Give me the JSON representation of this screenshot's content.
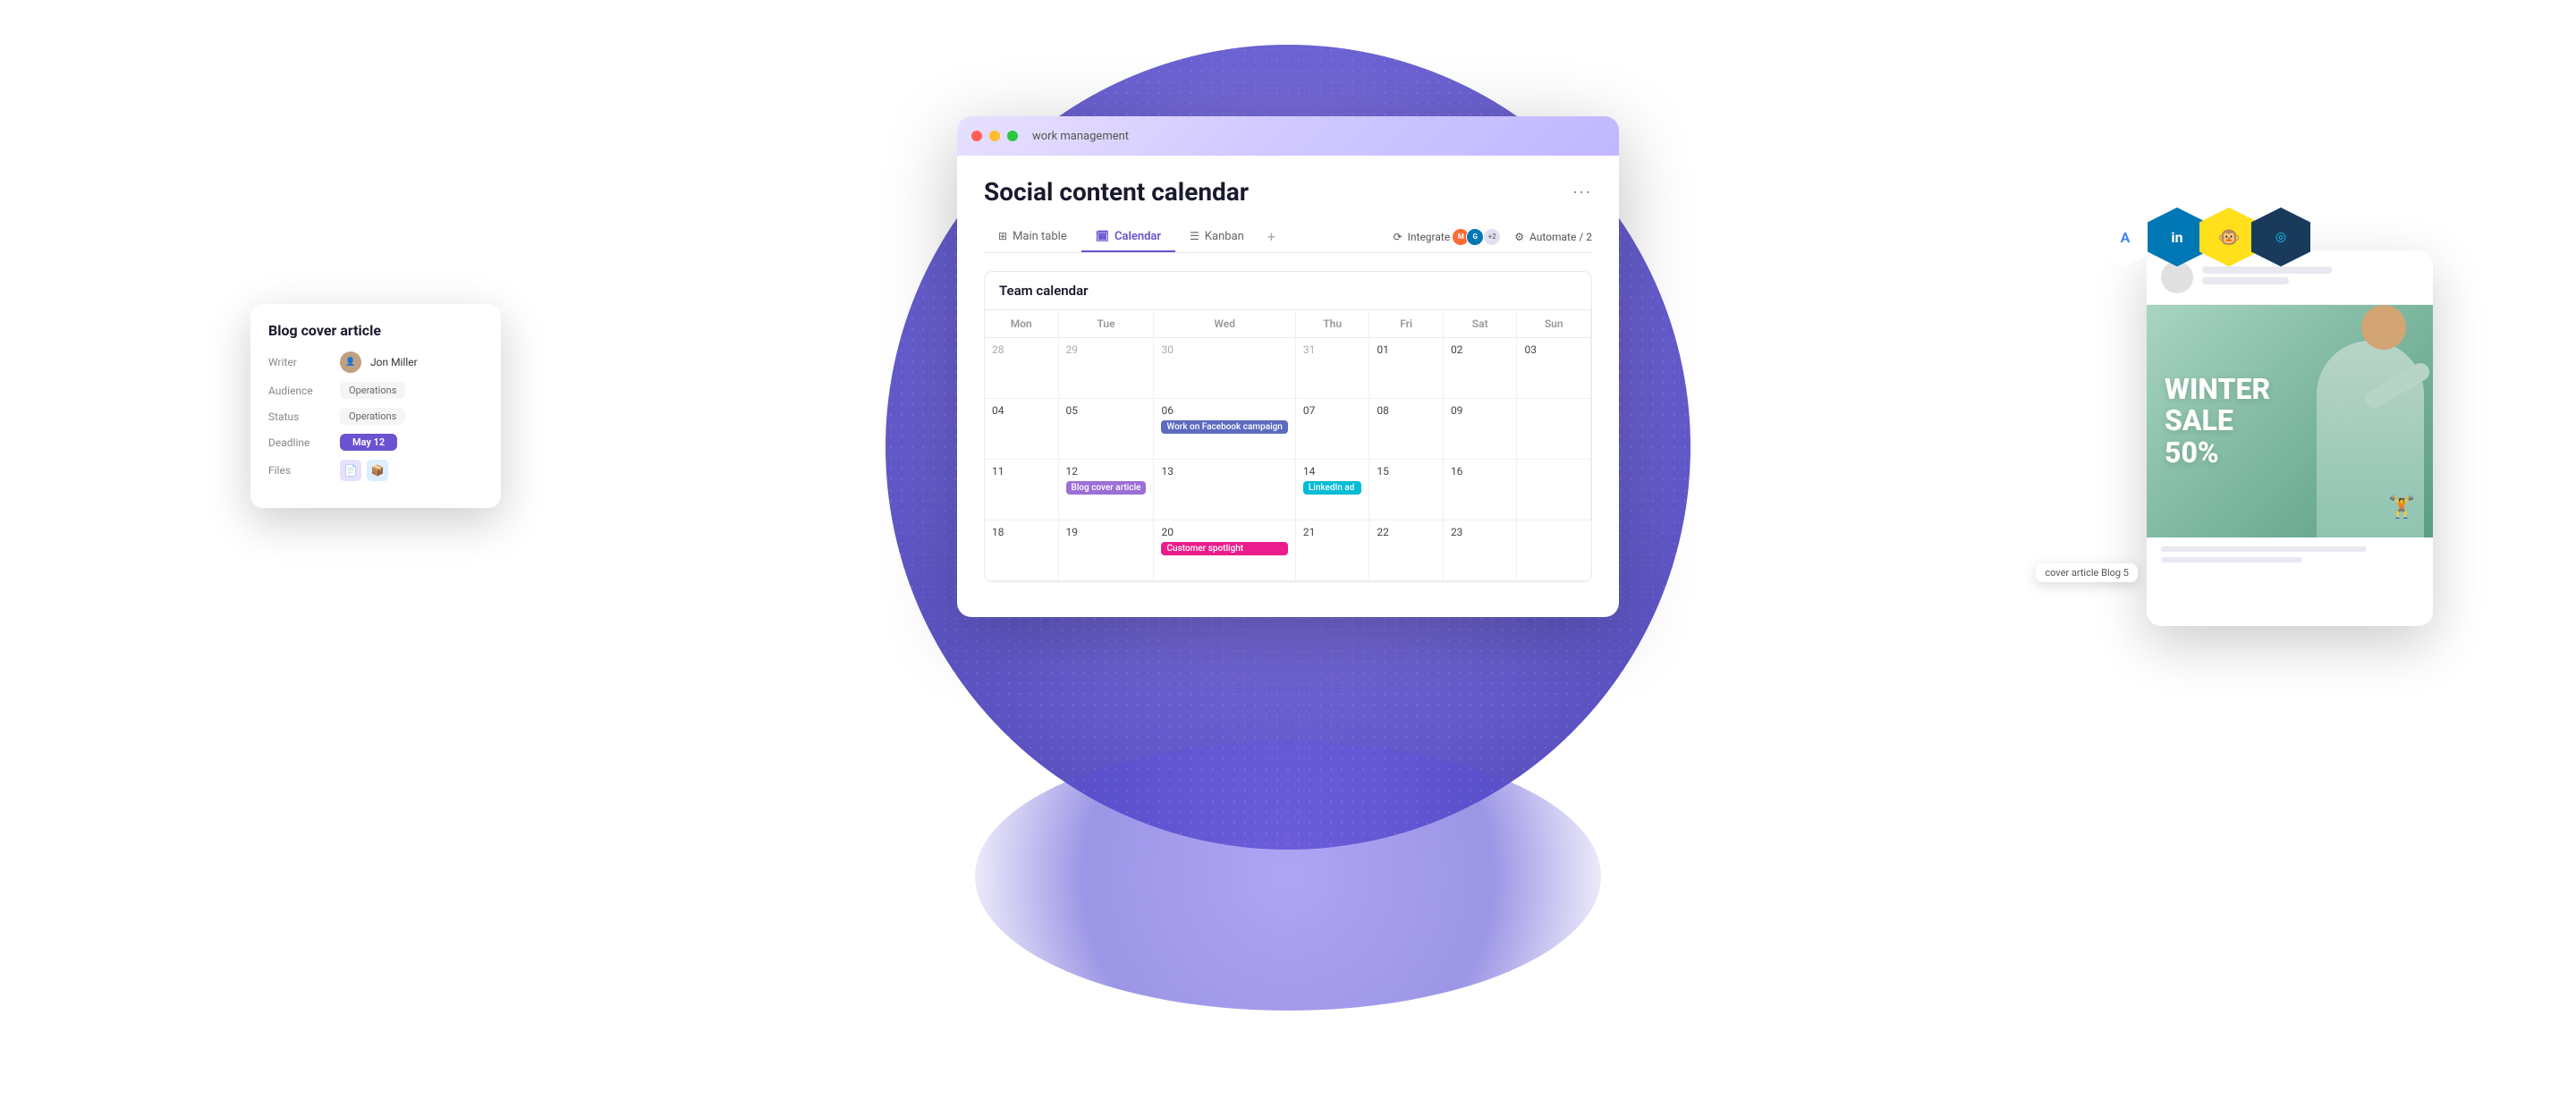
{
  "background": {
    "circle_color_start": "#7b68ee",
    "circle_color_end": "#4a3fc4"
  },
  "window": {
    "title": "work management",
    "buttons": [
      "close",
      "minimize",
      "maximize"
    ]
  },
  "app": {
    "title": "Social content calendar",
    "more_button": "···",
    "tabs": [
      {
        "id": "main-table",
        "label": "Main table",
        "icon": "⊞",
        "active": false
      },
      {
        "id": "calendar",
        "label": "Calendar",
        "icon": "📅",
        "active": true
      },
      {
        "id": "kanban",
        "label": "Kanban",
        "icon": "⊟",
        "active": false
      }
    ],
    "tab_add": "+",
    "actions": {
      "integrate": "Integrate",
      "integrate_count": "+2",
      "automate": "Automate / 2"
    }
  },
  "calendar": {
    "header": "Team calendar",
    "days": [
      "Mon",
      "Tue",
      "Wed",
      "Thu",
      "Fri",
      "Sat",
      "Sun"
    ],
    "weeks": [
      {
        "days": [
          {
            "num": "28",
            "current": false,
            "events": []
          },
          {
            "num": "29",
            "current": false,
            "events": []
          },
          {
            "num": "30",
            "current": false,
            "events": []
          },
          {
            "num": "31",
            "current": false,
            "events": []
          },
          {
            "num": "01",
            "current": true,
            "events": []
          },
          {
            "num": "02",
            "current": true,
            "events": []
          },
          {
            "num": "03",
            "current": true,
            "events": []
          }
        ]
      },
      {
        "days": [
          {
            "num": "04",
            "current": true,
            "events": []
          },
          {
            "num": "05",
            "current": true,
            "events": []
          },
          {
            "num": "06",
            "current": true,
            "events": [
              {
                "label": "Work on Facebook campaign",
                "color": "blue",
                "span": 3
              }
            ]
          },
          {
            "num": "07",
            "current": true,
            "events": []
          },
          {
            "num": "08",
            "current": true,
            "events": []
          },
          {
            "num": "09",
            "current": true,
            "events": []
          },
          {
            "num": "",
            "current": false,
            "events": []
          }
        ]
      },
      {
        "days": [
          {
            "num": "11",
            "current": true,
            "events": []
          },
          {
            "num": "12",
            "current": true,
            "events": [
              {
                "label": "Blog cover article",
                "color": "purple-light"
              }
            ]
          },
          {
            "num": "13",
            "current": true,
            "events": []
          },
          {
            "num": "14",
            "current": true,
            "events": [
              {
                "label": "LinkedIn ad",
                "color": "cyan",
                "span": 2
              }
            ]
          },
          {
            "num": "15",
            "current": true,
            "events": []
          },
          {
            "num": "16",
            "current": true,
            "events": []
          },
          {
            "num": "",
            "current": false,
            "events": []
          }
        ]
      },
      {
        "days": [
          {
            "num": "18",
            "current": true,
            "events": []
          },
          {
            "num": "19",
            "current": true,
            "events": []
          },
          {
            "num": "20",
            "current": true,
            "events": [
              {
                "label": "Customer spotlight",
                "color": "pink"
              }
            ]
          },
          {
            "num": "21",
            "current": true,
            "events": []
          },
          {
            "num": "22",
            "current": true,
            "events": []
          },
          {
            "num": "23",
            "current": true,
            "events": []
          },
          {
            "num": "",
            "current": false,
            "events": []
          }
        ]
      }
    ]
  },
  "blog_card": {
    "title": "Blog cover article",
    "fields": [
      {
        "label": "Writer",
        "type": "avatar",
        "value": "Jon Miller"
      },
      {
        "label": "Audience",
        "type": "pill",
        "value": "Operations"
      },
      {
        "label": "Status",
        "type": "pill",
        "value": "Operations"
      },
      {
        "label": "Deadline",
        "type": "deadline",
        "value": "May 12"
      },
      {
        "label": "Files",
        "type": "files",
        "value": ""
      }
    ]
  },
  "blog5_tag": {
    "label": "cover article Blog 5"
  },
  "ad_card": {
    "sale_text": "WINTER\nSALE\n50%"
  },
  "hex_icons": [
    {
      "bg": "#ffffff",
      "content": "A",
      "color": "#4285f4"
    },
    {
      "bg": "#0077b5",
      "content": "in",
      "color": "#ffffff"
    },
    {
      "bg": "#f4c430",
      "content": "🐵",
      "color": "#ffffff"
    },
    {
      "bg": "#1a3a5c",
      "content": "◎",
      "color": "#00d4ff"
    }
  ]
}
